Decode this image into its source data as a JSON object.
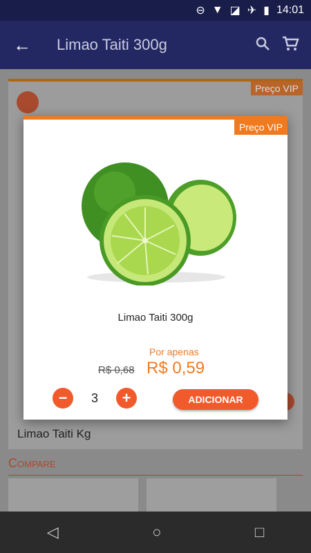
{
  "status": {
    "time": "14:01"
  },
  "appbar": {
    "title": "Limao Taiti 300g"
  },
  "background_card": {
    "badge": "Preço VIP",
    "name": "Limao Taiti Kg"
  },
  "compare": {
    "label": "Compare"
  },
  "modal": {
    "badge": "Preço VIP",
    "product_name": "Limao Taiti 300g",
    "por_apenas": "Por apenas",
    "old_price": "R$ 0,68",
    "price": "R$ 0,59",
    "quantity": "3",
    "add_label": "ADICIONAR"
  },
  "colors": {
    "accent": "#f07a20",
    "button": "#f15a2b",
    "appbar": "#232863"
  },
  "icons": [
    "back-arrow-icon",
    "search-icon",
    "cart-icon",
    "share-icon",
    "minus-icon",
    "plus-icon"
  ]
}
